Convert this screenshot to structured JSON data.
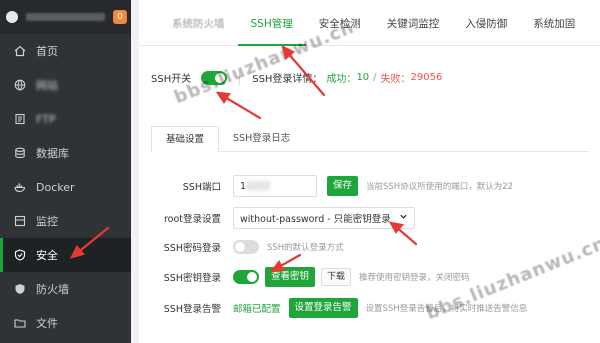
{
  "sidebar": {
    "badge": "0",
    "items": [
      {
        "label": "首页",
        "icon": "home-icon"
      },
      {
        "label": "网站",
        "icon": "globe-icon"
      },
      {
        "label": "FTP",
        "icon": "ftp-icon"
      },
      {
        "label": "数据库",
        "icon": "database-icon"
      },
      {
        "label": "Docker",
        "icon": "docker-icon"
      },
      {
        "label": "监控",
        "icon": "monitor-icon"
      },
      {
        "label": "安全",
        "icon": "shield-icon"
      },
      {
        "label": "防火墙",
        "icon": "firewall-icon"
      },
      {
        "label": "文件",
        "icon": "folder-icon"
      }
    ]
  },
  "tabs": [
    "系统防火墙",
    "SSH管理",
    "安全检测",
    "关键词监控",
    "入侵防御",
    "系统加固"
  ],
  "ssh": {
    "switch_label": "SSH开关",
    "login_detail_label": "SSH登录详情：",
    "success_label": "成功：",
    "success_count": "10",
    "divider": "/",
    "fail_label": "失败：",
    "fail_count": "29056"
  },
  "subtabs": [
    "基础设置",
    "SSH登录日志"
  ],
  "form": {
    "port_label": "SSH端口",
    "port_value": "1",
    "port_masked": "2222",
    "save_button": "保存",
    "port_hint": "当前SSH协议所使用的端口，默认为22",
    "root_label": "root登录设置",
    "root_value": "without-password - 只能密钥登录",
    "pwd_login_label": "SSH密码登录",
    "pwd_login_hint": "SSH的默认登录方式",
    "key_login_label": "SSH密钥登录",
    "view_key_button": "查看密钥",
    "download_button": "下载",
    "key_hint": "推荐使用密钥登录，关闭密码",
    "alert_label": "SSH登录告警",
    "alert_mail": "邮箱已配置",
    "alert_button": "设置登录告警",
    "alert_hint": "设置SSH登录告警后，将实时推送告警信息"
  },
  "colors": {
    "accent": "#20a53a",
    "danger": "#ef5350",
    "sidebar_bg": "#2f3336"
  },
  "watermark": "bbs.liuzhanwu.cn"
}
